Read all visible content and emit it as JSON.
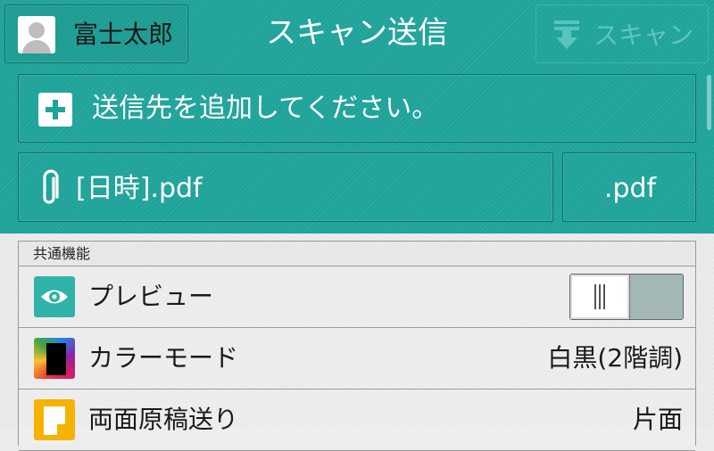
{
  "header": {
    "user_name": "富士太郎",
    "title": "スキャン送信",
    "scan_button_label": "スキャン"
  },
  "destination": {
    "add_label": "送信先を追加してください。"
  },
  "file": {
    "name": "[日時].pdf",
    "extension": ".pdf"
  },
  "settings": {
    "section_label": "共通機能",
    "rows": [
      {
        "label": "プレビュー",
        "icon": "eye-icon",
        "toggle_on": false
      },
      {
        "label": "カラーモード",
        "icon": "color-mode-icon",
        "value": "白黒(2階調)"
      },
      {
        "label": "両面原稿送り",
        "icon": "document-icon",
        "value": "片面"
      }
    ]
  },
  "colors": {
    "teal": "#1fa39a",
    "preview_icon": "#2fb3a9",
    "document_icon": "#f5b300"
  }
}
